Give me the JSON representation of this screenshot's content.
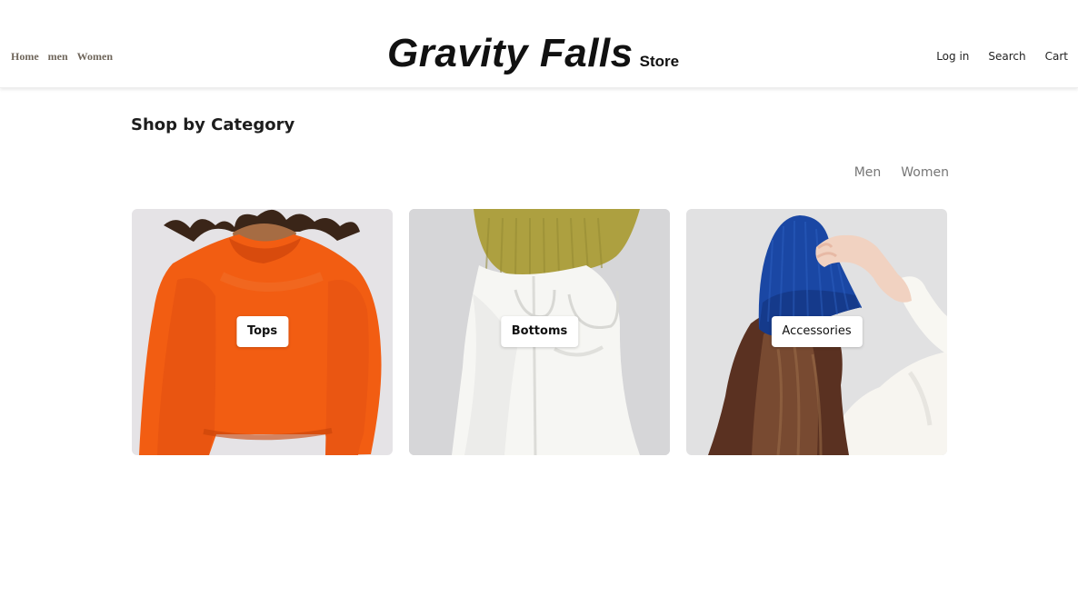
{
  "header": {
    "nav_left": [
      "Home",
      "men",
      "Women"
    ],
    "brand": {
      "logo": "Gravity Falls",
      "sub": "Store"
    },
    "nav_right": [
      "Log in",
      "Search",
      "Cart"
    ]
  },
  "main": {
    "section_title": "Shop by Category",
    "filters": [
      "Men",
      "Women"
    ],
    "categories": [
      {
        "label": "Tops",
        "image_description": "orange sweatshirt"
      },
      {
        "label": "Bottoms",
        "image_description": "white jeans"
      },
      {
        "label": "Accessories",
        "image_description": "blue beanie"
      }
    ]
  },
  "colors": {
    "nav_left": "#6f665b",
    "filter_text": "#767676",
    "tops_orange": "#f25d12",
    "bottoms_bg": "#c9c9cb",
    "accessory_blue": "#1a47a4"
  }
}
